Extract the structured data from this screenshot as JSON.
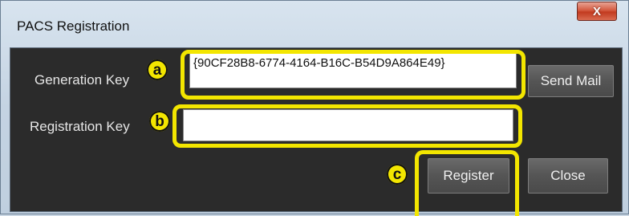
{
  "window": {
    "title": "PACS Registration",
    "close_label": "X"
  },
  "form": {
    "generation_key_label": "Generation Key",
    "generation_key_value": "{90CF28B8-6774-4164-B16C-B54D9A864E49}",
    "registration_key_label": "Registration Key",
    "registration_key_value": ""
  },
  "buttons": {
    "send_mail": "Send Mail",
    "register": "Register",
    "close": "Close"
  },
  "annotations": {
    "a": "a",
    "b": "b",
    "c": "c",
    "highlight_color": "#f3e600"
  }
}
